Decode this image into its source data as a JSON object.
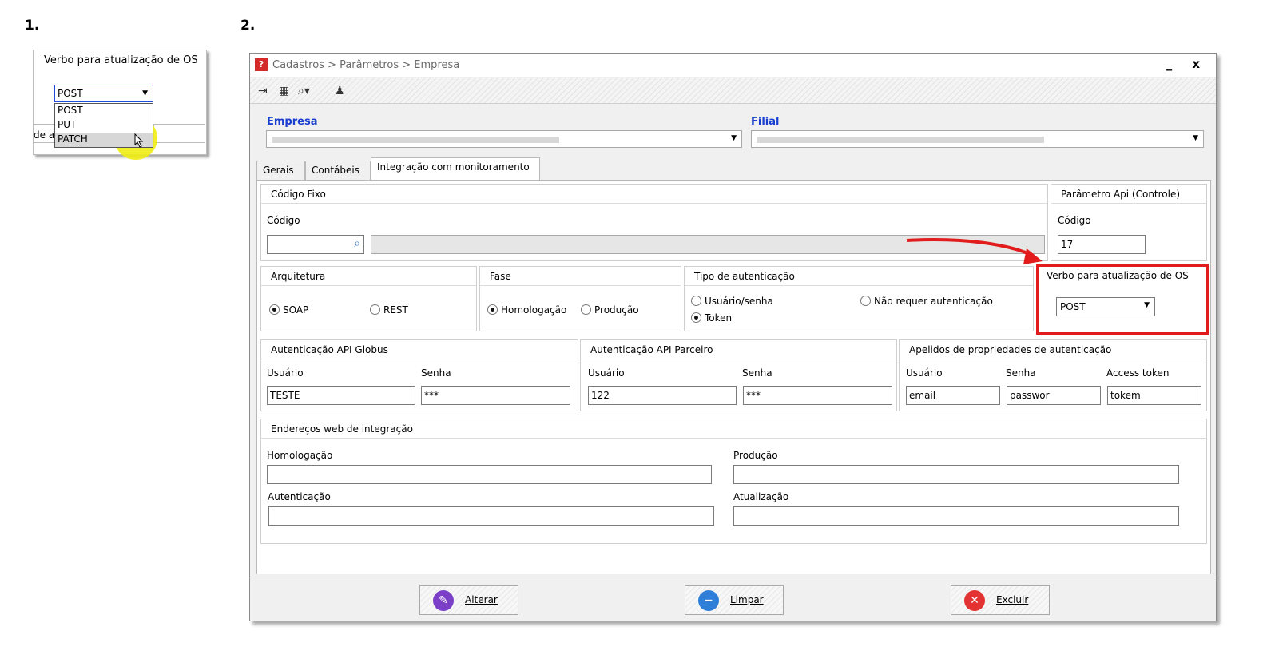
{
  "steps": {
    "one": "1.",
    "two": "2."
  },
  "panel1": {
    "title": "Verbo para atualização de OS",
    "selected": "POST",
    "options": [
      "POST",
      "PUT",
      "PATCH"
    ],
    "behind_text": "de au"
  },
  "window": {
    "title": "Cadastros > Parâmetros > Empresa",
    "app_icon_glyph": "?",
    "controls": "_ x",
    "toolbar_icons": [
      "exit-icon",
      "keyboard-icon",
      "search-icon",
      "user-icon"
    ]
  },
  "empresa": {
    "label": "Empresa"
  },
  "filial": {
    "label": "Filial"
  },
  "tabs": [
    "Gerais",
    "Contábeis",
    "Integração com monitoramento"
  ],
  "codigo_fixo": {
    "title": "Código Fixo",
    "field_label": "Código",
    "value": ""
  },
  "parametro_api": {
    "title": "Parâmetro Api (Controle)",
    "field_label": "Código",
    "value": "17"
  },
  "arquitetura": {
    "title": "Arquitetura",
    "options": [
      "SOAP",
      "REST"
    ],
    "selected": "SOAP"
  },
  "fase": {
    "title": "Fase",
    "options": [
      "Homologação",
      "Produção"
    ],
    "selected": "Homologação"
  },
  "tipo_autenticacao": {
    "title": "Tipo de autenticação",
    "options": [
      "Usuário/senha",
      "Token",
      "Não requer autenticação"
    ],
    "selected": "Token"
  },
  "verbo": {
    "title": "Verbo para atualização de OS",
    "selected": "POST"
  },
  "api_globus": {
    "title": "Autenticação API Globus",
    "user_label": "Usuário",
    "pass_label": "Senha",
    "user": "TESTE",
    "pass": "***"
  },
  "api_parceiro": {
    "title": "Autenticação API Parceiro",
    "user_label": "Usuário",
    "pass_label": "Senha",
    "user": "122",
    "pass": "***"
  },
  "apelidos": {
    "title": "Apelidos de propriedades de autenticação",
    "user_label": "Usuário",
    "pass_label": "Senha",
    "token_label": "Access token",
    "user": "email",
    "pass": "passwor",
    "token": "tokem"
  },
  "enderecos": {
    "title": "Endereços web de integração",
    "homologacao": "Homologação",
    "producao": "Produção",
    "autenticacao": "Autenticação",
    "atualizacao": "Atualização"
  },
  "buttons": {
    "alterar": "Alterar",
    "limpar": "Limpar",
    "excluir": "Excluir"
  },
  "colors": {
    "highlight_red": "#e21c1c",
    "label_blue": "#1a3fd0",
    "marker_yellow": "#f0ec14"
  }
}
